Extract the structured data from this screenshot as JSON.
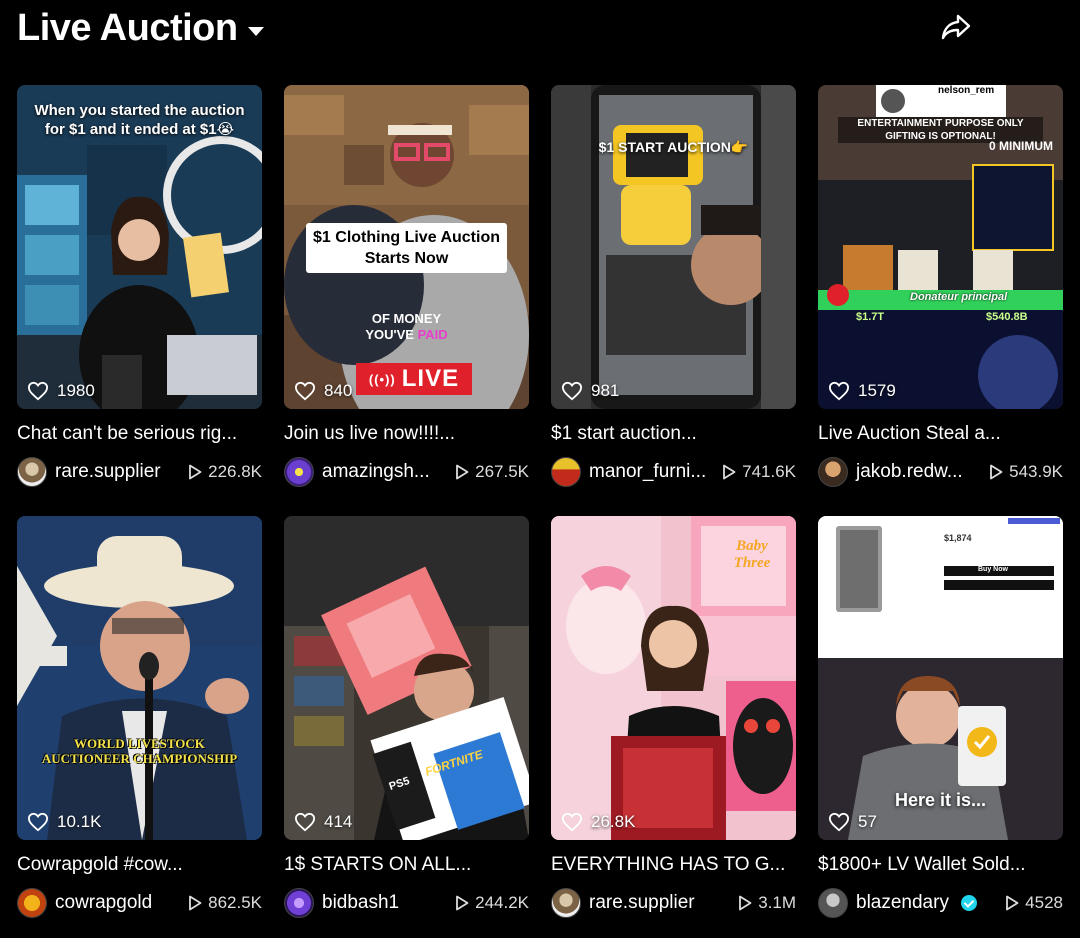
{
  "header": {
    "title": "Live Auction"
  },
  "colors": {
    "background": "#000000",
    "live_red": "#e0202a",
    "verified": "#20d5ec"
  },
  "icons": {
    "dropdown": "caret-down-icon",
    "share": "share-icon",
    "likes": "heart-icon",
    "views": "play-icon"
  },
  "videos": [
    {
      "likes": "1980",
      "title": "Chat can't be serious rig...",
      "author": "rare.supplier",
      "views": "226.8K",
      "overlay": "When you started the auction for $1 and it ended at $1😭"
    },
    {
      "likes": "840",
      "title": "Join us live now!!!!...",
      "author": "amazingsh...",
      "views": "267.5K",
      "overlay": "$1 Clothing Live Auction Starts Now",
      "overlay2": "OF MONEY",
      "overlay3": "YOU'VE",
      "overlay4": "PAID",
      "badge": "LIVE"
    },
    {
      "likes": "981",
      "title": "$1 start auction...",
      "author": "manor_furni...",
      "views": "741.6K",
      "overlay": "$1 START AUCTION👉"
    },
    {
      "likes": "1579",
      "title": "Live Auction Steal a...",
      "author": "jakob.redw...",
      "views": "543.9K",
      "overlay": "ENTERTAINMENT PURPOSE ONLY",
      "overlay2": "GIFTING IS OPTIONAL!",
      "overlay3": "0 MINIMUM",
      "overlay4": "nelson_rem",
      "overlay5": "$1.7T",
      "overlay6": "$540.8B",
      "overlay7": "Donateur principal"
    },
    {
      "likes": "10.1K",
      "title": "Cowrapgold #cow...",
      "author": "cowrapgold",
      "views": "862.5K",
      "overlay": "WORLD LIVESTOCK",
      "overlay2": "AUCTIONEER CHAMPIONSHIP"
    },
    {
      "likes": "414",
      "title": "1$ STARTS ON ALL...",
      "author": "bidbash1",
      "views": "244.2K",
      "overlay": "PS5",
      "overlay2": "FORTNITE"
    },
    {
      "likes": "26.8K",
      "title": "EVERYTHING HAS TO G...",
      "author": "rare.supplier",
      "views": "3.1M",
      "overlay": "Baby Three"
    },
    {
      "likes": "57",
      "title": "$1800+ LV Wallet Sold...",
      "author": "blazendary",
      "views": "4528",
      "verified": true,
      "overlay": "Here it is...",
      "overlay2": "$1,874",
      "overlay3": "Buy Now"
    }
  ]
}
